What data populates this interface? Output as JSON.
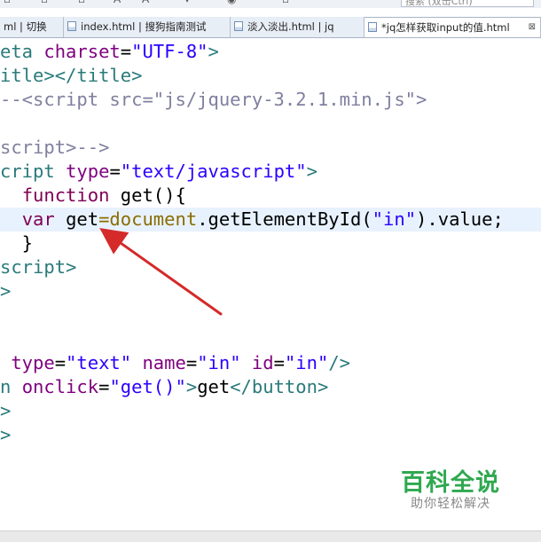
{
  "toolbar": {
    "search_text": "搜索 (双击Ctrl)"
  },
  "tabs": [
    {
      "label": "ml | 切换"
    },
    {
      "label": "index.html | 搜狗指南测试"
    },
    {
      "label": "淡入淡出.html | jq"
    },
    {
      "label": "*jq怎样获取input的值.html",
      "close": "⊠"
    }
  ],
  "code": [
    [
      [
        "t-tag",
        "eta "
      ],
      [
        "t-attr",
        "charset"
      ],
      [
        "t-plain",
        "="
      ],
      [
        "t-str",
        "\"UTF-8\""
      ],
      [
        "t-tag",
        ">"
      ]
    ],
    [
      [
        "t-tag",
        "itle></title>"
      ]
    ],
    [
      [
        "t-cmt",
        "--<script src=\"js/jquery-3.2.1.min.js\">"
      ]
    ],
    [],
    [
      [
        "t-cmt",
        "script>-->"
      ]
    ],
    [
      [
        "t-tag",
        "cript "
      ],
      [
        "t-attr",
        "type"
      ],
      [
        "t-plain",
        "="
      ],
      [
        "t-str",
        "\"text/javascript\""
      ],
      [
        "t-tag",
        ">"
      ]
    ],
    [
      [
        "t-plain",
        "  "
      ],
      [
        "t-kw",
        "function "
      ],
      [
        "t-fn",
        "get(){"
      ]
    ],
    [
      [
        "t-plain",
        "  "
      ],
      [
        "t-kw",
        "var "
      ],
      [
        "t-plain",
        "get"
      ],
      [
        "t-doc",
        "=document"
      ],
      [
        "t-plain",
        ".getElementById("
      ],
      [
        "t-str",
        "\"in\""
      ],
      [
        "t-plain",
        ").value;"
      ]
    ],
    [
      [
        "t-plain",
        "  }"
      ]
    ],
    [
      [
        "t-tag",
        "script>"
      ]
    ],
    [
      [
        "t-tag",
        ">"
      ]
    ],
    [],
    [],
    [
      [
        "t-plain",
        " "
      ],
      [
        "t-attr",
        "type"
      ],
      [
        "t-plain",
        "="
      ],
      [
        "t-str",
        "\"text\" "
      ],
      [
        "t-attr",
        "name"
      ],
      [
        "t-plain",
        "="
      ],
      [
        "t-str",
        "\"in\" "
      ],
      [
        "t-attr",
        "id"
      ],
      [
        "t-plain",
        "="
      ],
      [
        "t-str",
        "\"in\""
      ],
      [
        "t-tag",
        "/>"
      ]
    ],
    [
      [
        "t-tag",
        "n "
      ],
      [
        "t-attr",
        "onclick"
      ],
      [
        "t-plain",
        "="
      ],
      [
        "t-str",
        "\"get()\""
      ],
      [
        "t-tag",
        ">"
      ],
      [
        "t-plain",
        "get"
      ],
      [
        "t-tag",
        "</button>"
      ]
    ],
    [
      [
        "t-tag",
        ">"
      ]
    ],
    [
      [
        "t-tag",
        ">"
      ]
    ]
  ],
  "highlight_line": 7,
  "watermark": {
    "title": "百科全说",
    "subtitle": "助你轻松解决"
  }
}
